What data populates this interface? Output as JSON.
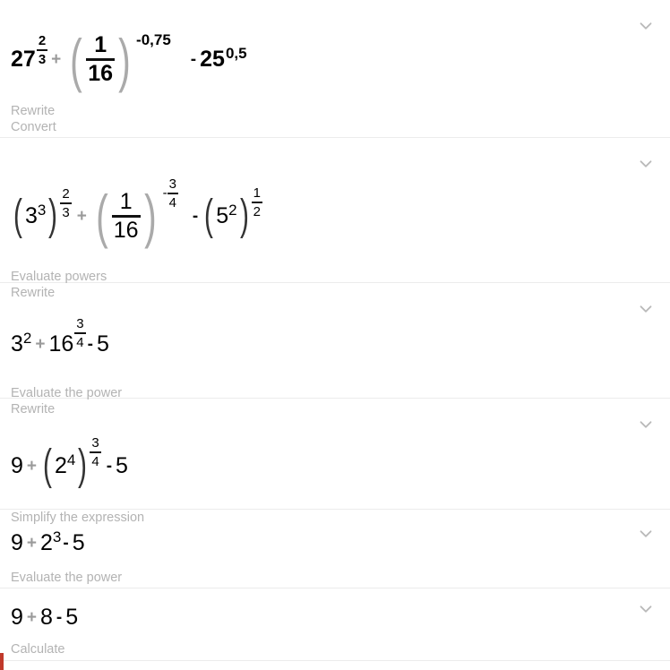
{
  "app": {
    "background_color": "#ffffff",
    "divider_color": "#ececec",
    "hint_color": "#b3b3b3",
    "expression_color": "#000000",
    "accent_bar_color": "#c0392b",
    "chevron_color": "#b9b9b9"
  },
  "accent_bar": {
    "name": "red-accent-bar",
    "visible": true
  },
  "steps": [
    {
      "id": "step-1",
      "expression_plain": "27^(2/3) + (1/16)^(-0,75) - 25^(0,5)",
      "parts": {
        "t1_base": "27",
        "t1_exp_num": "2",
        "t1_exp_den": "3",
        "op1": "+",
        "t2_num": "1",
        "t2_den": "16",
        "t2_exp": "-0,75",
        "op2": "-",
        "t3_base": "25",
        "t3_exp": "0,5"
      },
      "hints": [
        "Rewrite",
        "Convert"
      ],
      "chevron": "chevron-down-icon"
    },
    {
      "id": "step-2",
      "expression_plain": "(3^3)^(2/3) + (1/16)^(-3/4) - (5^2)^(1/2)",
      "parts": {
        "t1_base": "3",
        "t1_inner_exp": "3",
        "t1_exp_num": "2",
        "t1_exp_den": "3",
        "op1": "+",
        "t2_num": "1",
        "t2_den": "16",
        "t2_exp_sign": "-",
        "t2_exp_num": "3",
        "t2_exp_den": "4",
        "op2": "-",
        "t3_base": "5",
        "t3_inner_exp": "2",
        "t3_exp_num": "1",
        "t3_exp_den": "2"
      },
      "hints": [
        "Evaluate powers",
        "Rewrite"
      ],
      "chevron": "chevron-down-icon"
    },
    {
      "id": "step-3",
      "expression_plain": "3^2 + 16^(3/4) - 5",
      "parts": {
        "t1_base": "3",
        "t1_exp": "2",
        "op1": "+",
        "t2_base": "16",
        "t2_exp_num": "3",
        "t2_exp_den": "4",
        "op2": "-",
        "t3": "5"
      },
      "hints": [
        "Evaluate the power",
        "Rewrite"
      ],
      "chevron": "chevron-down-icon"
    },
    {
      "id": "step-4",
      "expression_plain": "9 + (2^4)^(3/4) - 5",
      "parts": {
        "t1": "9",
        "op1": "+",
        "t2_base": "2",
        "t2_inner_exp": "4",
        "t2_exp_num": "3",
        "t2_exp_den": "4",
        "op2": "-",
        "t3": "5"
      },
      "hints": [
        "Simplify the expression"
      ],
      "chevron": "chevron-down-icon"
    },
    {
      "id": "step-5",
      "expression_plain": "9 + 2^3 - 5",
      "parts": {
        "t1": "9",
        "op1": "+",
        "t2_base": "2",
        "t2_exp": "3",
        "op2": "-",
        "t3": "5"
      },
      "hints": [
        "Evaluate the power"
      ],
      "chevron": "chevron-down-icon"
    },
    {
      "id": "step-6",
      "expression_plain": "9 + 8 - 5",
      "parts": {
        "t1": "9",
        "op1": "+",
        "t2": "8",
        "op2": "-",
        "t3": "5"
      },
      "hints": [
        "Calculate"
      ],
      "chevron": "chevron-down-icon"
    }
  ]
}
